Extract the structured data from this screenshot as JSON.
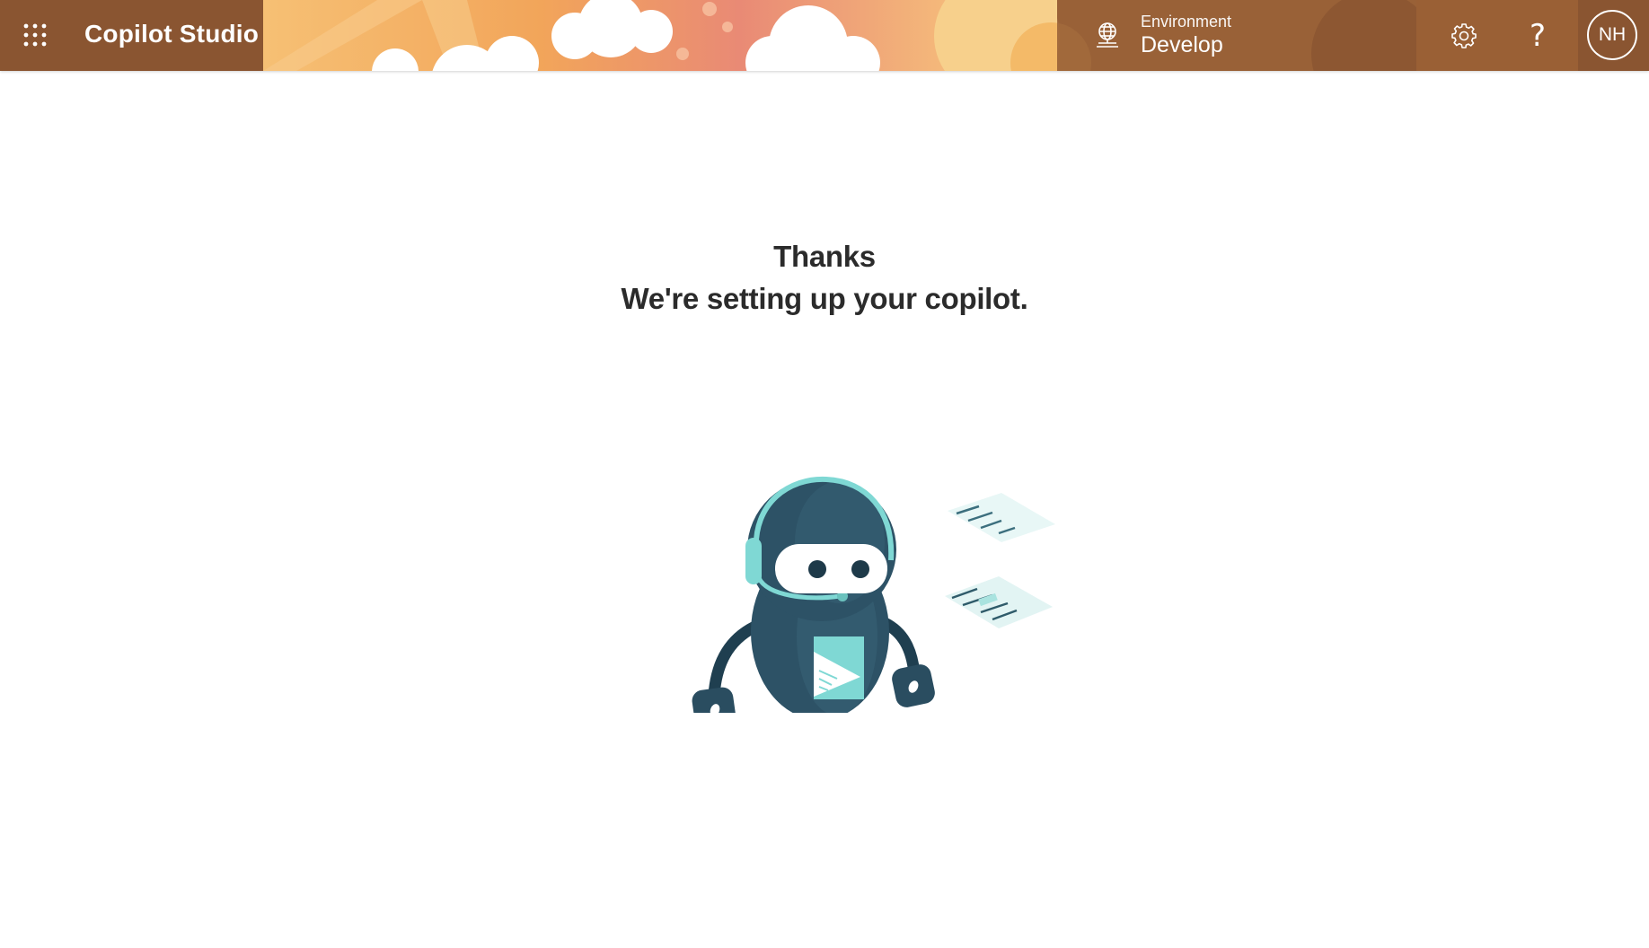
{
  "header": {
    "app_title": "Copilot Studio",
    "environment": {
      "label": "Environment",
      "value": "Develop"
    },
    "avatar_initials": "NH",
    "help_glyph": "?",
    "icons": {
      "waffle": "app-launcher-icon",
      "environment": "globe-icon",
      "settings": "gear-icon",
      "help": "question-icon"
    },
    "colors": {
      "header_bg": "#8a5531",
      "banner_orange": "#f2a55a",
      "banner_pink": "#e98a75"
    }
  },
  "main": {
    "line1": "Thanks",
    "line2": "We're setting up your copilot."
  },
  "illustration": {
    "subject": "robot-with-headset",
    "colors": {
      "body": "#2d5266",
      "accent": "#7fd8d4",
      "face": "#ffffff"
    }
  }
}
